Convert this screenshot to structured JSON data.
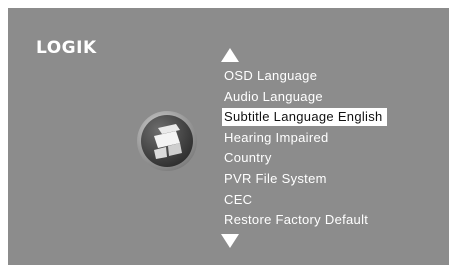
{
  "brand": {
    "logo_text": "LOGIK"
  },
  "menu": {
    "items": [
      {
        "label": "OSD Language",
        "selected": false
      },
      {
        "label": "Audio Language",
        "selected": false
      },
      {
        "label": "Subtitle Language English",
        "selected": true
      },
      {
        "label": "Hearing Impaired",
        "selected": false
      },
      {
        "label": "Country",
        "selected": false
      },
      {
        "label": "PVR File System",
        "selected": false
      },
      {
        "label": "CEC",
        "selected": false
      },
      {
        "label": "Restore Factory Default",
        "selected": false
      }
    ]
  },
  "icons": {
    "category": "settings-badge-icon",
    "scroll_up": "triangle-up-icon",
    "scroll_down": "triangle-down-icon"
  },
  "colors": {
    "background": "#8c8c8c",
    "text": "#ffffff",
    "highlight_bg": "#ffffff",
    "highlight_text": "#111111"
  }
}
